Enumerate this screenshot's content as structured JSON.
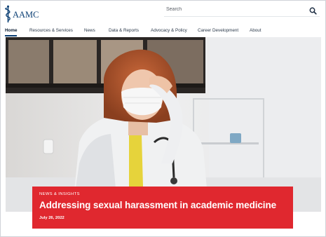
{
  "brand": {
    "name": "AAMC"
  },
  "search": {
    "placeholder": "Search",
    "value": ""
  },
  "nav": {
    "items": [
      {
        "label": "Home",
        "active": true
      },
      {
        "label": "Resources & Services"
      },
      {
        "label": "News"
      },
      {
        "label": "Data & Reports"
      },
      {
        "label": "Advocacy & Policy"
      },
      {
        "label": "Career Development"
      },
      {
        "label": "About"
      }
    ]
  },
  "hero": {
    "eyebrow": "NEWS & INSIGHTS",
    "title": "Addressing sexual harassment in academic medicine",
    "date": "July 26, 2022"
  },
  "colors": {
    "brand_blue": "#0b3f74",
    "card_red": "#e0282f"
  },
  "icons": [
    "aamc-caduceus-logo-icon",
    "search-icon"
  ]
}
